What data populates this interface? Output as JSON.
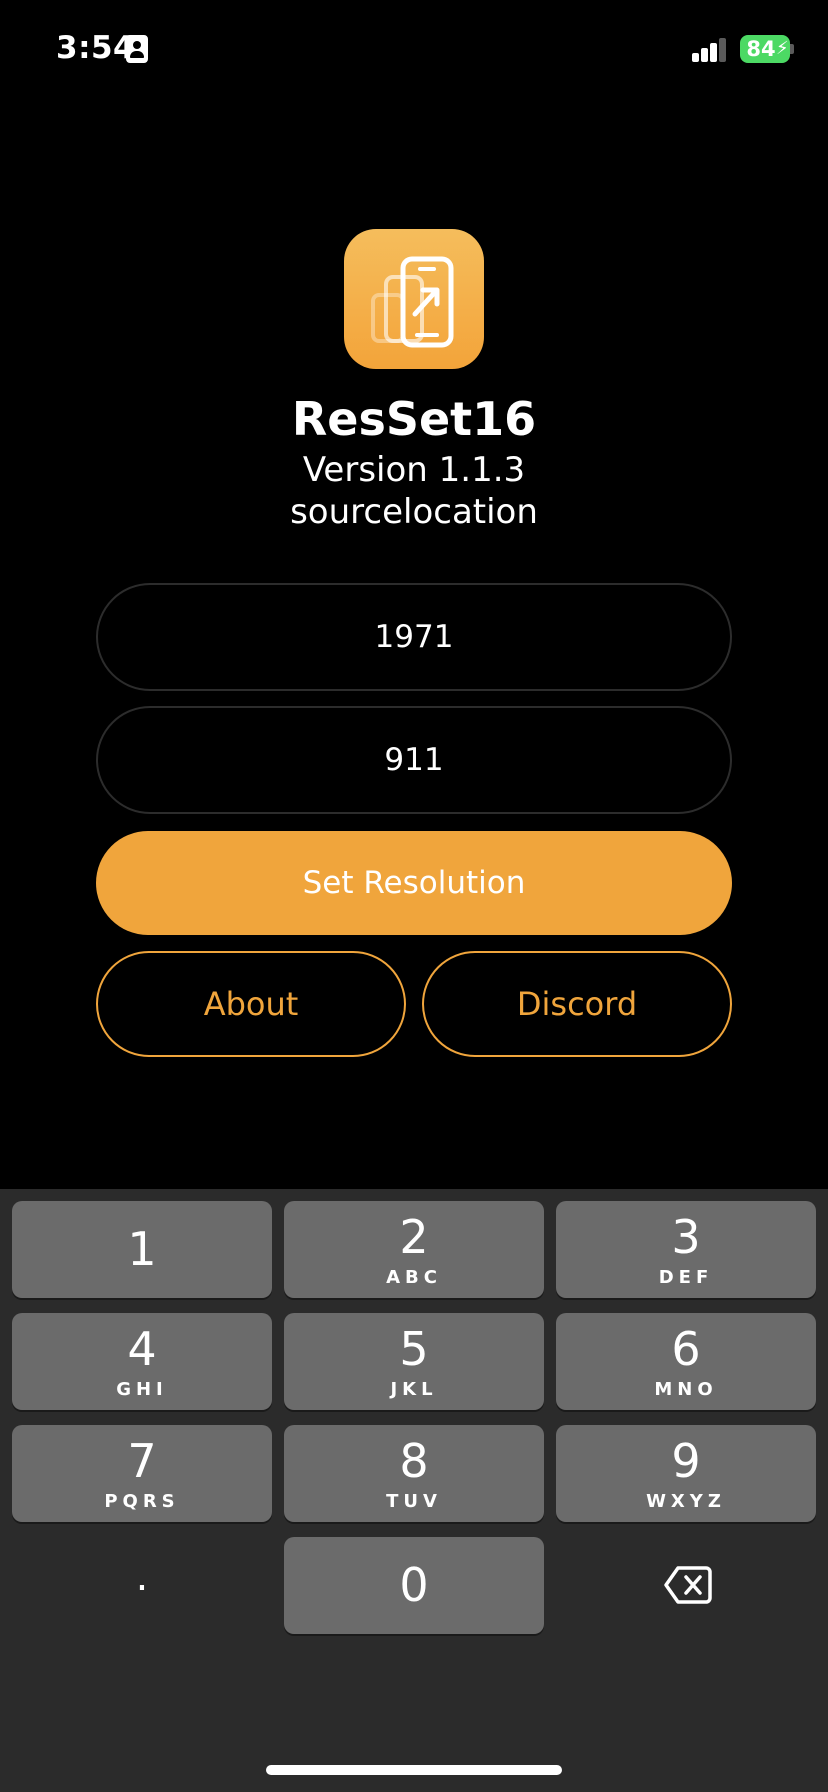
{
  "status_bar": {
    "time": "3:54",
    "battery_level": "84",
    "icons": [
      "id-card-icon",
      "signal-icon",
      "battery-charging-icon"
    ]
  },
  "app": {
    "name": "ResSet16",
    "version": "Version 1.1.3",
    "author": "sourcelocation",
    "icon": "phone-resize-icon"
  },
  "form": {
    "width_value": "1971",
    "height_value": "911",
    "set_resolution_label": "Set Resolution",
    "about_label": "About",
    "discord_label": "Discord"
  },
  "keypad": {
    "keys": [
      {
        "num": "1",
        "letters": ""
      },
      {
        "num": "2",
        "letters": "ABC"
      },
      {
        "num": "3",
        "letters": "DEF"
      },
      {
        "num": "4",
        "letters": "GHI"
      },
      {
        "num": "5",
        "letters": "JKL"
      },
      {
        "num": "6",
        "letters": "MNO"
      },
      {
        "num": "7",
        "letters": "PQRS"
      },
      {
        "num": "8",
        "letters": "TUV"
      },
      {
        "num": "9",
        "letters": "WXYZ"
      },
      {
        "num": "0",
        "letters": ""
      }
    ],
    "dot": ".",
    "delete_icon": "backspace-icon"
  },
  "colors": {
    "accent": "#f0a53c",
    "background": "#000000",
    "keypad_bg": "#2b2b2b",
    "key_bg": "#6b6b6b",
    "battery": "#4cd964"
  }
}
